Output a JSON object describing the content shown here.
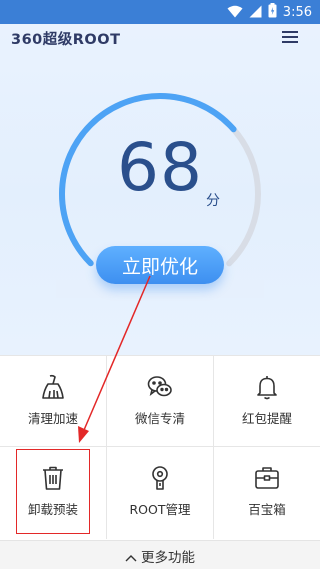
{
  "status_bar": {
    "time": "3:56",
    "icons": [
      "wifi-icon",
      "signal-icon",
      "battery-icon"
    ]
  },
  "header": {
    "logo": "360超级ROOT",
    "menu_icon": "menu-icon"
  },
  "score": {
    "value": "68",
    "unit": "分",
    "gauge_fill_fraction": 0.68
  },
  "optimize_button": {
    "label": "立即优化"
  },
  "features": [
    {
      "label": "清理加速",
      "icon": "broom-icon"
    },
    {
      "label": "微信专清",
      "icon": "wechat-icon"
    },
    {
      "label": "红包提醒",
      "icon": "bell-icon"
    },
    {
      "label": "卸载预装",
      "icon": "trash-icon"
    },
    {
      "label": "ROOT管理",
      "icon": "keyhole-icon"
    },
    {
      "label": "百宝箱",
      "icon": "toolbox-icon"
    }
  ],
  "more": {
    "label": "更多功能",
    "icon": "chevron-up-icon"
  },
  "colors": {
    "status_bar": "#3b7fd6",
    "accent": "#3d8ff0",
    "score_text": "#2a4f8c",
    "highlight": "#e32828"
  }
}
